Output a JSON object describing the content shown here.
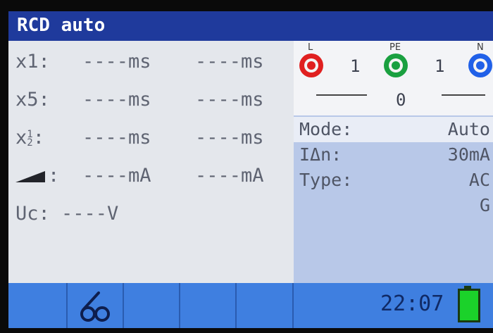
{
  "title": "RCD auto",
  "measurements": [
    {
      "label": "x1:",
      "value1": "----ms",
      "value2": "----ms"
    },
    {
      "label": "x5:",
      "value1": "----ms",
      "value2": "----ms"
    },
    {
      "label": ":",
      "value1": "----ms",
      "value2": "----ms"
    },
    {
      "label": ":",
      "value1": "----mA",
      "value2": "----mA"
    },
    {
      "label": "Uc:",
      "value1": "----V",
      "value2": ""
    }
  ],
  "half_prefix": "x",
  "half_fraction_num": "1",
  "half_fraction_den": "2",
  "terminals": {
    "L": {
      "label": "L",
      "color": "#e02020"
    },
    "PE": {
      "label": "PE",
      "color": "#1aa040"
    },
    "N": {
      "label": "N",
      "color": "#2060e8"
    },
    "L_PE": "1",
    "PE_N": "1",
    "L_N": "0"
  },
  "params": [
    {
      "label": "Mode:",
      "value": "Auto"
    },
    {
      "label": "IΔn:",
      "value": "30mA"
    },
    {
      "label": "Type:",
      "value": "AC"
    },
    {
      "label": "",
      "value": "G"
    }
  ],
  "bottom": {
    "time": "22:07",
    "fkey2_icon": "test-leads-icon",
    "battery_icon": "battery-full-icon"
  }
}
